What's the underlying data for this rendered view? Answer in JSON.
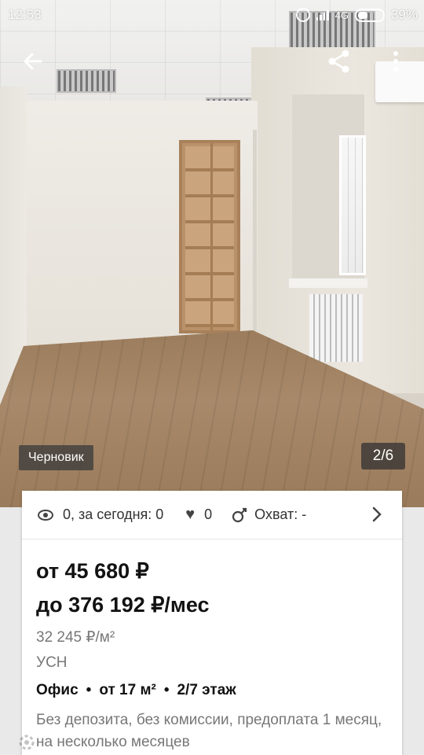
{
  "status_bar": {
    "time": "12:53",
    "network": "4G",
    "battery": "39%",
    "battery_level": 0.39
  },
  "toolbar": {
    "back_icon": "arrow-left-icon",
    "share_icon": "share-icon",
    "more_icon": "more-vert-icon"
  },
  "gallery": {
    "draft_label": "Черновик",
    "counter": "2/6"
  },
  "stats": {
    "views": "0, за сегодня: 0",
    "favorites": "0",
    "reach": "Охват: -"
  },
  "listing": {
    "price_from": "от 45 680 ₽",
    "price_to": "до 376 192 ₽/мес",
    "price_per_sqm": "32 245 ₽/м²",
    "tax": "УСН",
    "facts": [
      "Офис",
      "от 17 м²",
      "2/7 этаж"
    ],
    "terms": "Без депозита, без комиссии, предоплата 1 месяц, на несколько месяцев"
  },
  "colors": {
    "card_bg": "#ffffff",
    "text_primary": "#121212",
    "text_secondary": "#777777"
  }
}
